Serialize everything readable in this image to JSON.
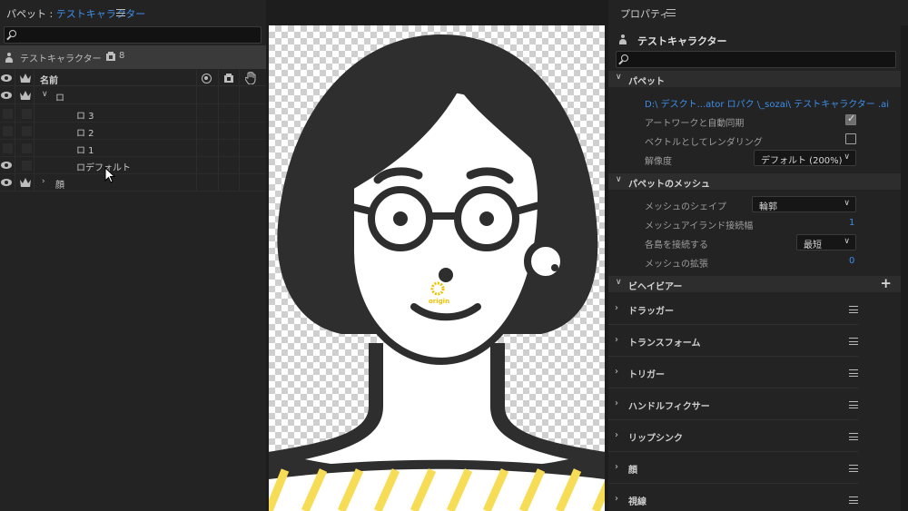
{
  "left_panel": {
    "title_prefix": "パペット : ",
    "title_name": "テストキャラクター",
    "search": {
      "placeholder": ""
    },
    "puppet": {
      "name": "テストキャラクター",
      "count": "8"
    },
    "columns": {
      "name": "名前"
    },
    "rows": [
      {
        "label": "ロ",
        "visible": true,
        "independent": true,
        "expanded": true
      },
      {
        "label": "ロ 3"
      },
      {
        "label": "ロ 2"
      },
      {
        "label": "ロ 1"
      },
      {
        "label": "ロデフォルト",
        "visible": true
      },
      {
        "label": "顔",
        "visible": true,
        "independent": true,
        "expanded": false
      }
    ]
  },
  "canvas": {
    "origin_label": "origin"
  },
  "right_panel": {
    "title": "プロパティ",
    "puppet_name": "テストキャラクター",
    "search": {
      "placeholder": ""
    },
    "sections": {
      "puppet": {
        "label": "パペット",
        "path": "D:\\ デスクト...ator ロパク \\_sozai\\ テストキャラクター .ai",
        "artwork_sync_label": "アートワークと自動同期",
        "artwork_sync_checked": true,
        "vector_render_label": "ベクトルとしてレンダリング",
        "vector_render_checked": false,
        "resolution_label": "解像度",
        "resolution_value": "デフォルト (200%)"
      },
      "mesh": {
        "label": "パペットのメッシュ",
        "shape_label": "メッシュのシェイプ",
        "shape_value": "輪郭",
        "island_label": "メッシュアイランド接続幅",
        "island_value": "1",
        "connect_label": "各島を接続する",
        "connect_value": "最短",
        "expand_label": "メッシュの拡張",
        "expand_value": "0"
      },
      "behavior": {
        "label": "ビヘイビアー",
        "items": [
          "ドラッガー",
          "トランスフォーム",
          "トリガー",
          "ハンドルフィクサー",
          "リップシンク",
          "顔",
          "視線"
        ]
      }
    }
  },
  "colors": {
    "accent": "#3d8ee8",
    "origin": "#f0c200",
    "stripe": "#f7dc55"
  }
}
